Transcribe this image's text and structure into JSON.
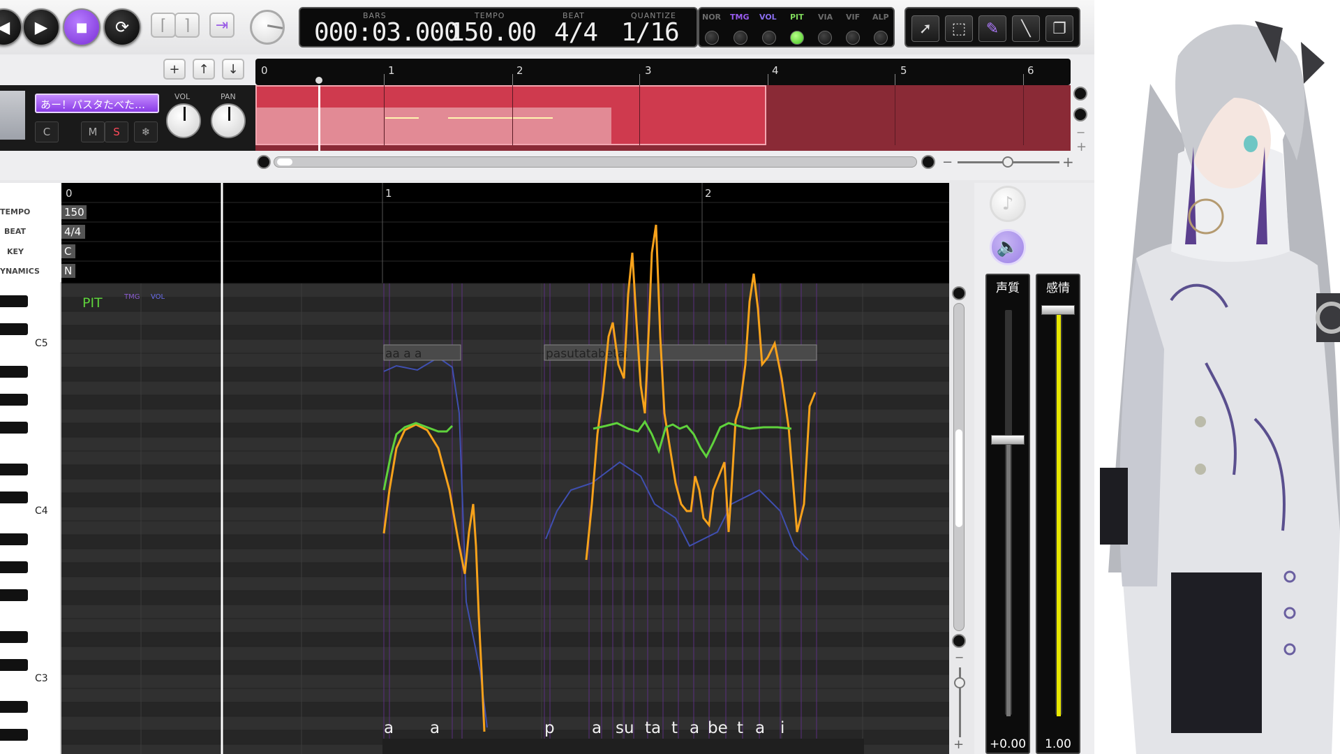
{
  "transport": {
    "bars_label": "BARS",
    "bars_value": "000:03.000",
    "tempo_label": "TEMPO",
    "tempo_value": "150.00",
    "beat_label": "BEAT",
    "beat_value": "4/4",
    "quantize_label": "QUANTIZE",
    "quantize_value": "1/16"
  },
  "param_toggles": [
    "NOR",
    "TMG",
    "VOL",
    "PIT",
    "VIA",
    "VIF",
    "ALP"
  ],
  "active_param": "PIT",
  "track": {
    "name": "あー！パスタたべた…",
    "vol_label": "VOL",
    "pan_label": "PAN",
    "mute_label": "M",
    "solo_label": "S",
    "c_label": "C"
  },
  "song_bars": [
    "0",
    "1",
    "2",
    "3",
    "4",
    "5",
    "6"
  ],
  "editor": {
    "bars": [
      "0",
      "1",
      "2"
    ],
    "rows": [
      {
        "label": "TEMPO",
        "value": "150"
      },
      {
        "label": "BEAT",
        "value": "4/4"
      },
      {
        "label": "KEY",
        "value": "C"
      },
      {
        "label": "YNAMICS",
        "value": "N"
      }
    ],
    "mode_label": "PIT",
    "sub_modes": [
      "TMG",
      "VOL"
    ],
    "octaves": [
      "C5",
      "C4",
      "C3"
    ],
    "note_texts": [
      "aa a a",
      "pasutatabetai"
    ],
    "lyrics": [
      "a",
      "a",
      "p",
      "a",
      "su",
      "ta",
      "t",
      "a",
      "be",
      "t",
      "a",
      "i"
    ]
  },
  "faders": {
    "voice_label": "声質",
    "voice_value": "+0.00",
    "voice_level": 0.68,
    "emotion_label": "感情",
    "emotion_value": "1.00",
    "emotion_level": 1.0
  },
  "colors": {
    "accent": "#8a3ce6",
    "track_red": "#c8374b",
    "pitch_orange": "#f7a21b",
    "pitch_green": "#5fd23c",
    "fader_yellow": "#e8e800"
  }
}
